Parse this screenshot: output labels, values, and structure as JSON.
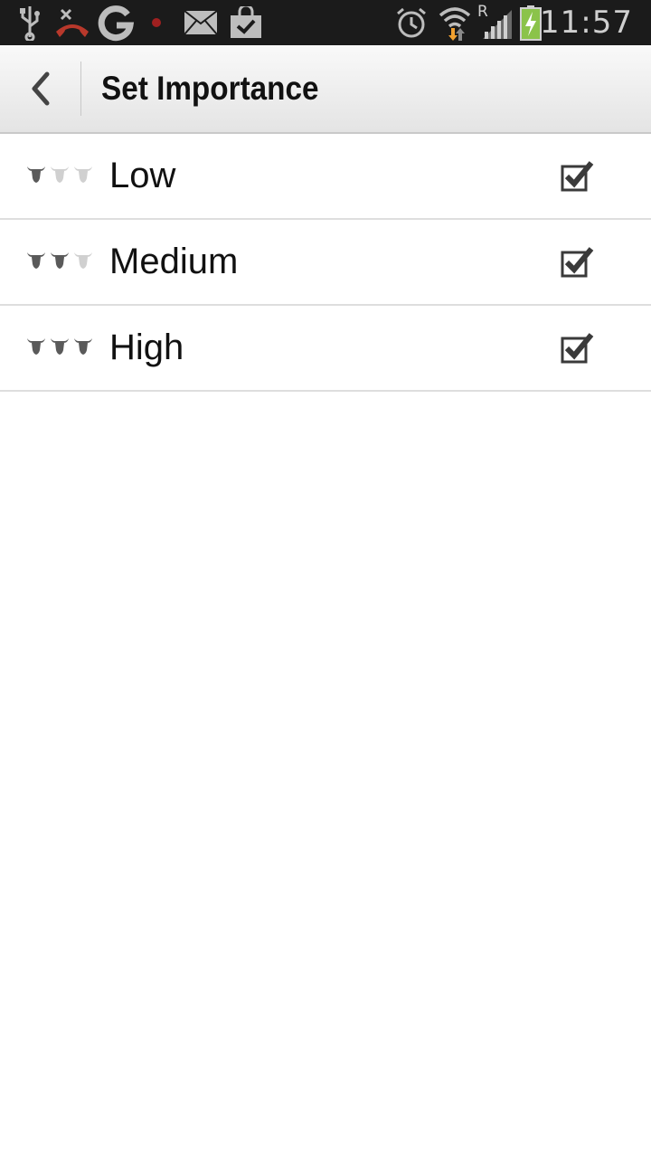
{
  "status_bar": {
    "time": "11:57",
    "network_letter": "R",
    "icons": [
      "usb-icon",
      "missed-call-icon",
      "google-g-icon",
      "notification-dot-icon",
      "mail-icon",
      "shopping-bag-check-icon",
      "alarm-clock-icon",
      "wifi-icon",
      "signal-icon",
      "battery-charging-icon"
    ],
    "colors": {
      "missed_call": "#c0392b",
      "battery": "#8bc34a",
      "wifi_arrow": "#f0a030"
    }
  },
  "action_bar": {
    "title": "Set Importance",
    "back_icon": "chevron-left-icon"
  },
  "importance_levels": [
    {
      "label": "Low",
      "active_bulls": 1,
      "checked": true
    },
    {
      "label": "Medium",
      "active_bulls": 2,
      "checked": true
    },
    {
      "label": "High",
      "active_bulls": 3,
      "checked": true
    }
  ],
  "colors": {
    "bull_active": "#5a5a5a",
    "bull_inactive": "#d0d0d0"
  }
}
